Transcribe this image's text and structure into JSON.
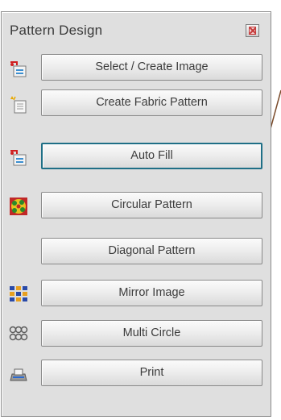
{
  "panel": {
    "title": "Pattern Design",
    "close_icon": "close-icon",
    "buttons": [
      {
        "label": "Select / Create Image",
        "icon": "select-image-icon",
        "active": false
      },
      {
        "label": "Create Fabric Pattern",
        "icon": "fabric-pattern-icon",
        "active": false
      },
      {
        "label": "Auto Fill",
        "icon": "auto-fill-icon",
        "active": true
      },
      {
        "label": "Circular Pattern",
        "icon": "circular-pattern-icon",
        "active": false
      },
      {
        "label": "Diagonal Pattern",
        "icon": "",
        "active": false
      },
      {
        "label": "Mirror Image",
        "icon": "mirror-image-icon",
        "active": false
      },
      {
        "label": "Multi Circle",
        "icon": "multi-circle-icon",
        "active": false
      },
      {
        "label": "Print",
        "icon": "print-icon",
        "active": false
      }
    ]
  },
  "colors": {
    "panel_bg": "#dfdfdf",
    "active_border": "#1f6f86",
    "callout_line": "#7a4a2a"
  }
}
